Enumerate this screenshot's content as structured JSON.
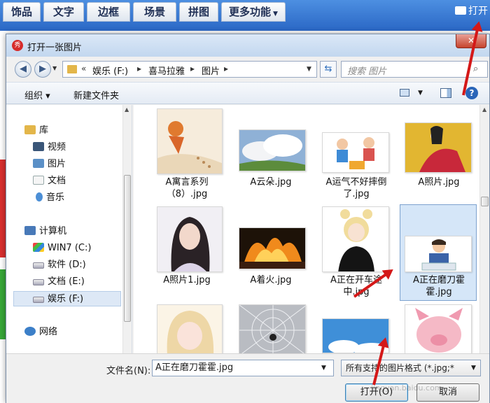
{
  "app_toolbar": {
    "tabs": [
      {
        "label": "饰品"
      },
      {
        "label": "文字"
      },
      {
        "label": "边框"
      },
      {
        "label": "场景"
      },
      {
        "label": "拼图"
      },
      {
        "label": "更多功能"
      }
    ],
    "open_label": "打开"
  },
  "dialog": {
    "title": "打开一张图片",
    "app_icon_text": "秀",
    "close_label": "✕",
    "address": {
      "prefix": "«",
      "segments": [
        "娱乐 (F:)",
        "喜马拉雅",
        "图片"
      ],
      "separator": "▸"
    },
    "search_placeholder": "搜索 图片",
    "commands": {
      "organize": "组织 ▾",
      "new_folder": "新建文件夹"
    },
    "nav": {
      "library": "库",
      "video": "视频",
      "pictures": "图片",
      "documents": "文档",
      "music": "音乐",
      "computer": "计算机",
      "drive_c": "WIN7 (C:)",
      "drive_d": "软件 (D:)",
      "drive_e": "文档 (E:)",
      "drive_f": "娱乐 (F:)",
      "network": "网络"
    },
    "files": [
      {
        "name": "A寓言系列（8）.jpg",
        "selected": false
      },
      {
        "name": "A云朵.jpg",
        "selected": false
      },
      {
        "name": "A运气不好摔倒了.jpg",
        "selected": false
      },
      {
        "name": "A照片.jpg",
        "selected": false
      },
      {
        "name": "A照片1.jpg",
        "selected": false
      },
      {
        "name": "A着火.jpg",
        "selected": false
      },
      {
        "name": "A正在开车途中.jpg",
        "selected": false
      },
      {
        "name": "A正在磨刀霍霍.jpg",
        "selected": true
      },
      {
        "name": "",
        "selected": false
      },
      {
        "name": "",
        "selected": false
      },
      {
        "name": "",
        "selected": false
      },
      {
        "name": "",
        "selected": false
      }
    ],
    "filename_label": "文件名(N):",
    "filename_value": "A正在磨刀霍霍.jpg",
    "filetype_value": "所有支持的图片格式 (*.jpg;*",
    "open_button": "打开(O)",
    "cancel_button": "取消"
  },
  "watermark": "jingyan.baidu.com",
  "colors": {
    "accent_red": "#d41818",
    "selection": "#d5e6f8"
  }
}
